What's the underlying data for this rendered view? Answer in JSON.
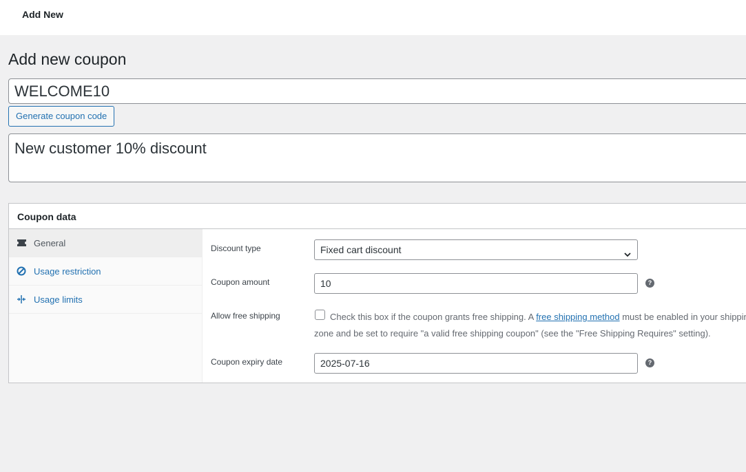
{
  "topbar": {
    "title": "Add New"
  },
  "page": {
    "title": "Add new coupon"
  },
  "coupon": {
    "code": "WELCOME10",
    "generate_label": "Generate coupon code",
    "description": "New customer 10% discount"
  },
  "panel": {
    "title": "Coupon data",
    "tabs": [
      {
        "label": "General",
        "icon": "ticket-icon",
        "active": true
      },
      {
        "label": "Usage restriction",
        "icon": "block-icon",
        "active": false
      },
      {
        "label": "Usage limits",
        "icon": "limits-icon",
        "active": false
      }
    ],
    "fields": {
      "discount_type": {
        "label": "Discount type",
        "value": "Fixed cart discount"
      },
      "amount": {
        "label": "Coupon amount",
        "value": "10"
      },
      "free_shipping": {
        "label": "Allow free shipping",
        "checked": false,
        "text_before": "Check this box if the coupon grants free shipping. A ",
        "link": "free shipping method",
        "text_after": " must be enabled in your shipping zone and be set to require \"a valid free shipping coupon\" (see the \"Free Shipping Requires\" setting)."
      },
      "expiry": {
        "label": "Coupon expiry date",
        "value": "2025-07-16"
      }
    },
    "help_glyph": "?"
  },
  "colors": {
    "accent": "#2271b1",
    "background": "#f0f0f1"
  }
}
